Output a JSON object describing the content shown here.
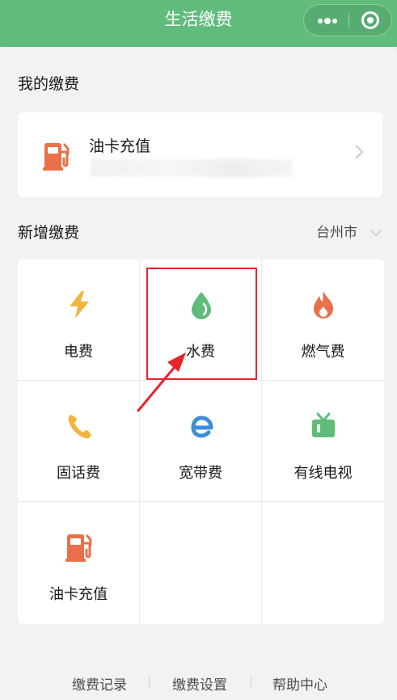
{
  "header": {
    "title": "生活缴费"
  },
  "colors": {
    "header_bg": "#5fbc7b",
    "highlight": "#e8232a",
    "electric": "#f2b43c",
    "water": "#5fbc7b",
    "gas": "#e9704a",
    "phone": "#f2b43c",
    "broadband": "#3d8ed8",
    "tv": "#5fbc7b",
    "fuel": "#e9704a"
  },
  "my_payments": {
    "title": "我的缴费",
    "card": {
      "label": "油卡充值",
      "icon": "fuel-pump-icon"
    }
  },
  "new_payment": {
    "title": "新增缴费",
    "city": "台州市",
    "items": [
      {
        "label": "电费",
        "icon": "lightning-icon"
      },
      {
        "label": "水费",
        "icon": "water-drop-icon"
      },
      {
        "label": "燃气费",
        "icon": "flame-icon"
      },
      {
        "label": "固话费",
        "icon": "phone-icon"
      },
      {
        "label": "宽带费",
        "icon": "broadband-e-icon"
      },
      {
        "label": "有线电视",
        "icon": "tv-icon"
      },
      {
        "label": "油卡充值",
        "icon": "fuel-pump-icon"
      }
    ]
  },
  "footer": {
    "links": [
      "缴费记录",
      "缴费设置",
      "帮助中心"
    ]
  }
}
